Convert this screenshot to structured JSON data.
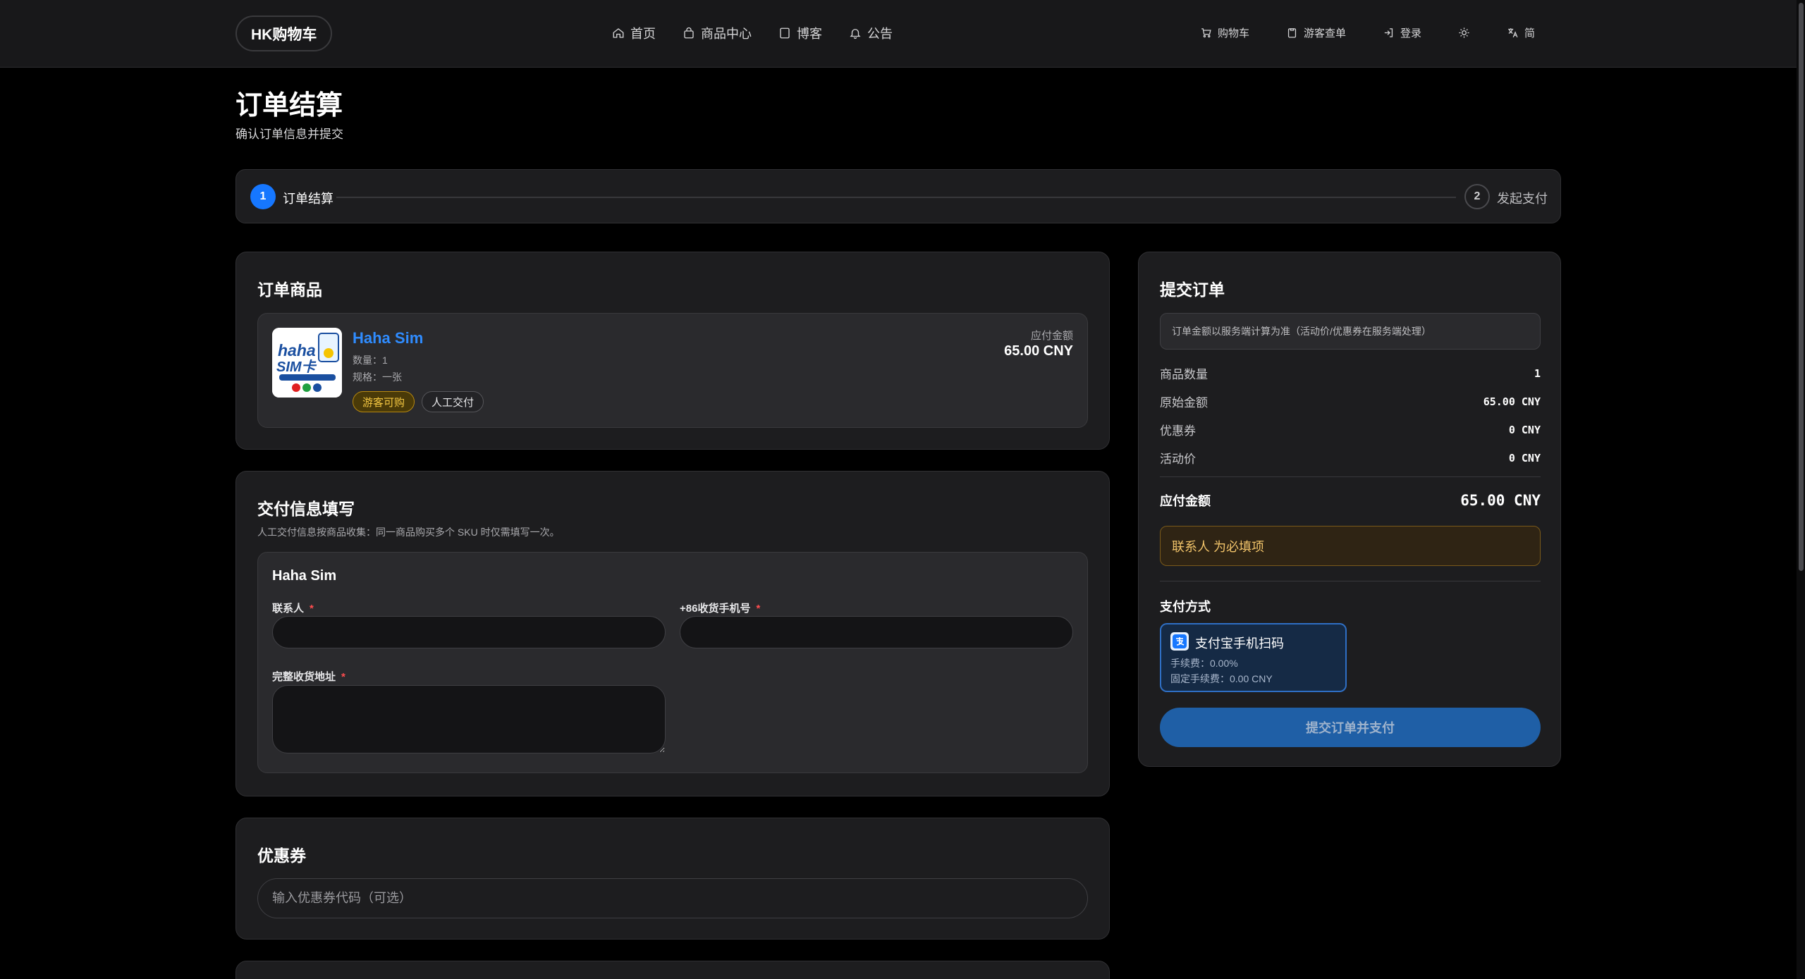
{
  "header": {
    "brand": "HK购物车",
    "nav": [
      {
        "label": "首页",
        "icon": "home-icon"
      },
      {
        "label": "商品中心",
        "icon": "bag-icon"
      },
      {
        "label": "博客",
        "icon": "document-icon"
      },
      {
        "label": "公告",
        "icon": "bell-icon"
      }
    ],
    "tools": {
      "cart": "购物车",
      "guest_orders": "游客查单",
      "login": "登录",
      "language": "简"
    }
  },
  "page": {
    "title": "订单结算",
    "subtitle": "确认订单信息并提交"
  },
  "stepper": {
    "steps": [
      {
        "number": "1",
        "label": "订单结算",
        "active": true
      },
      {
        "number": "2",
        "label": "发起支付",
        "active": false
      }
    ]
  },
  "order": {
    "title": "订单商品",
    "product": {
      "name": "Haha Sim",
      "thumb_logo_line1": "haha",
      "thumb_logo_line2": "SIM卡",
      "quantity": "数量：1",
      "spec": "规格：一张",
      "tags": [
        "游客可购",
        "人工交付"
      ],
      "amount_label": "应付金额",
      "amount": "65.00 CNY"
    }
  },
  "delivery": {
    "title": "交付信息填写",
    "description": "人工交付信息按商品收集：同一商品购买多个 SKU 时仅需填写一次。",
    "product_name": "Haha Sim",
    "fields": {
      "contact": {
        "label": "联系人",
        "required": "*",
        "value": ""
      },
      "phone": {
        "label": "+86收货手机号",
        "required": "*",
        "value": ""
      },
      "address": {
        "label": "完整收货地址",
        "required": "*",
        "value": ""
      }
    }
  },
  "coupon": {
    "title": "优惠券",
    "placeholder": "输入优惠券代码（可选）"
  },
  "summary": {
    "title": "提交订单",
    "notice": "订单金额以服务端计算为准（活动价/优惠券在服务端处理）",
    "rows": [
      {
        "label": "商品数量",
        "value": "1"
      },
      {
        "label": "原始金额",
        "value": "65.00 CNY"
      },
      {
        "label": "优惠券",
        "value": "0 CNY"
      },
      {
        "label": "活动价",
        "value": "0 CNY"
      }
    ],
    "total_label": "应付金额",
    "total_value": "65.00 CNY",
    "warning": "联系人 为必填项",
    "payment_title": "支付方式",
    "payment": {
      "name": "支付宝手机扫码",
      "fee": "手续费：0.00%",
      "fixed_fee": "固定手续费：0.00 CNY"
    },
    "submit_label": "提交订单并支付"
  },
  "colors": {
    "background": "#000000",
    "card": "#1d1d1f",
    "accent": "#1677ff",
    "product_link": "#2f8cff",
    "warning": "#f2c46a",
    "submit": "#1f5fa6"
  }
}
